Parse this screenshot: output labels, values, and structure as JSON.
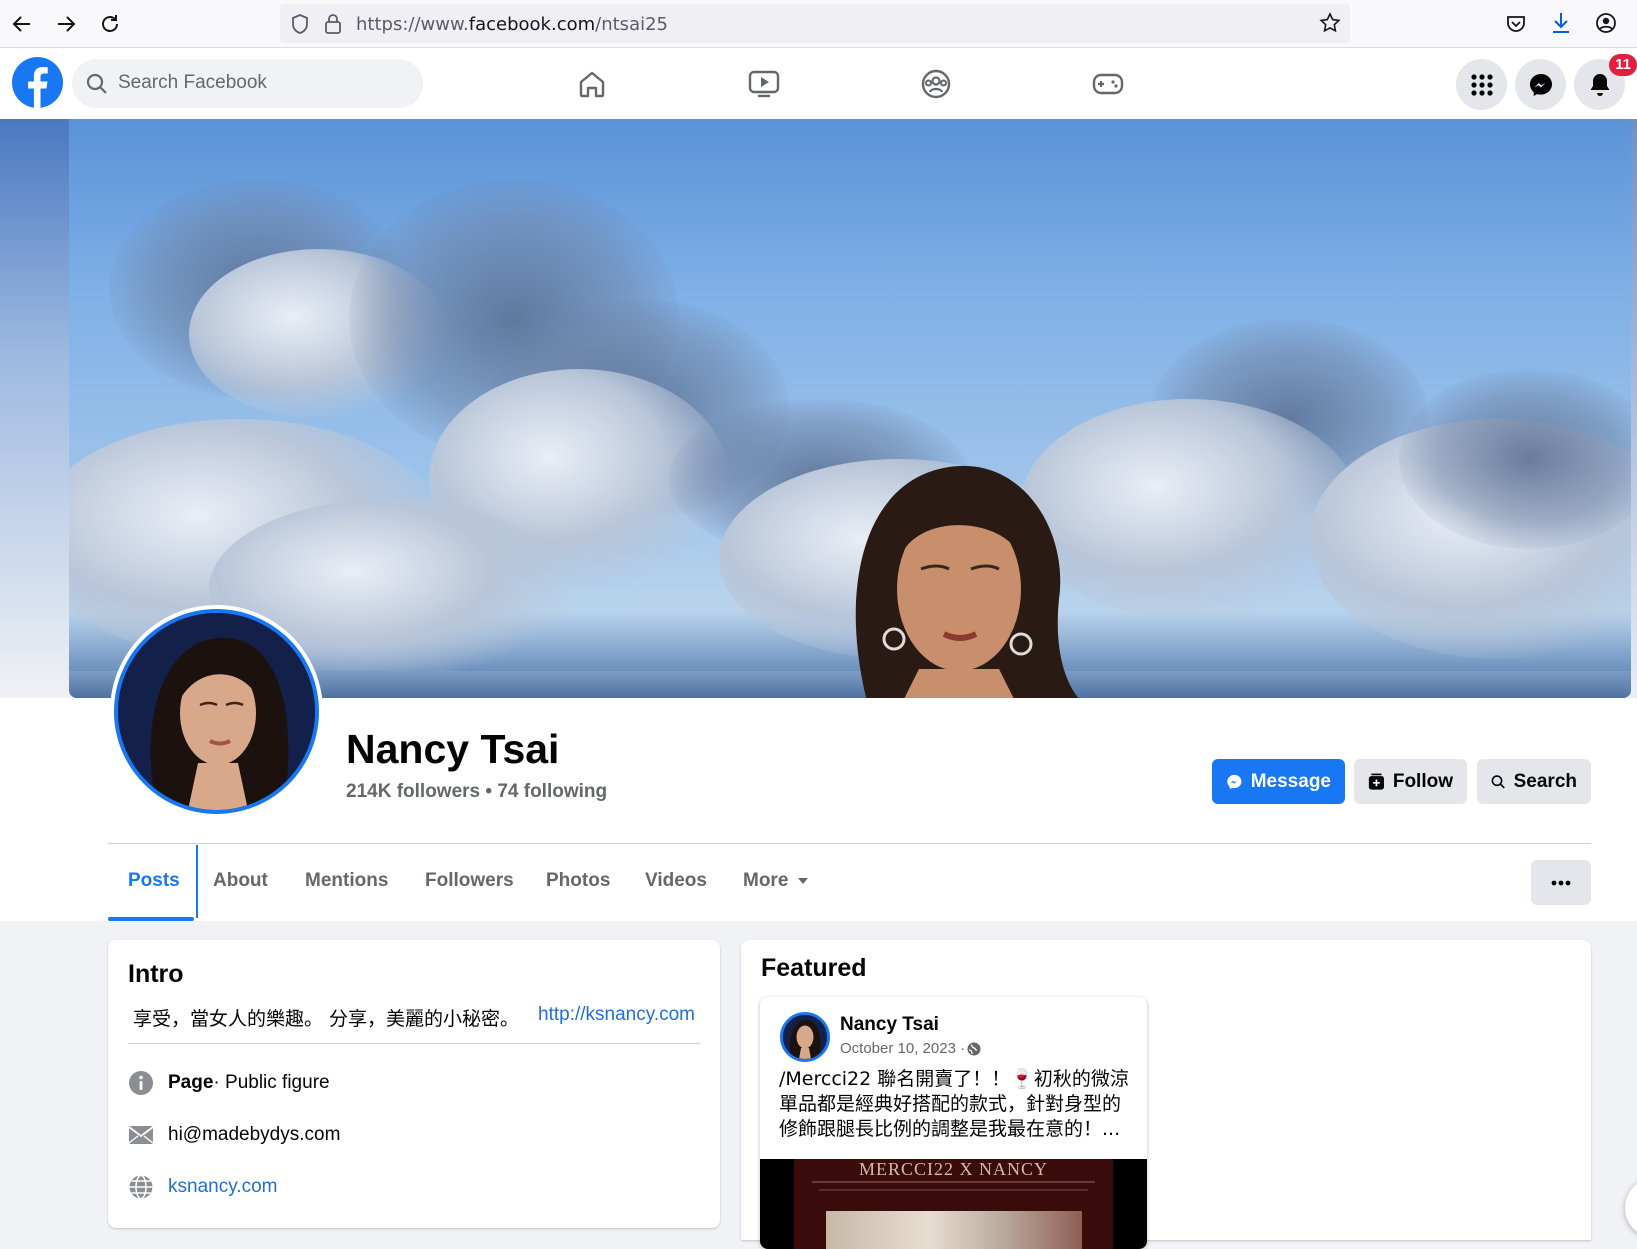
{
  "browser": {
    "url_prefix": "https://www.",
    "url_host": "facebook.com",
    "url_path": "/ntsai25"
  },
  "header": {
    "search_placeholder": "Search Facebook",
    "notification_count": "11"
  },
  "profile": {
    "name": "Nancy Tsai",
    "followers": "214K followers",
    "separator": " • ",
    "following": "74 following",
    "message_label": "Message",
    "follow_label": "Follow",
    "search_label": "Search"
  },
  "tabs": [
    {
      "label": "Posts"
    },
    {
      "label": "About"
    },
    {
      "label": "Mentions"
    },
    {
      "label": "Followers"
    },
    {
      "label": "Photos"
    },
    {
      "label": "Videos"
    },
    {
      "label": "More"
    }
  ],
  "intro": {
    "title": "Intro",
    "bio": "享受，當女人的樂趣。 分享，美麗的小秘密。",
    "bio_link": "http://ksnancy.com",
    "page_label": "Page",
    "page_category": " · Public figure",
    "email": "hi@madebydys.com",
    "website": "ksnancy.com"
  },
  "featured": {
    "title": "Featured",
    "post": {
      "author": "Nancy Tsai",
      "date": "October 10, 2023 · ",
      "text": "/Mercci22 聯名開賣了！！🍷初秋的微涼單品都是經典好搭配的款式，針對身型的修飾跟腿長比例的調整是我最在意的！...",
      "image_title": "MERCCI22 X NANCY"
    }
  },
  "colors": {
    "brand_blue": "#1877f2",
    "badge_red": "#e41e3f"
  }
}
